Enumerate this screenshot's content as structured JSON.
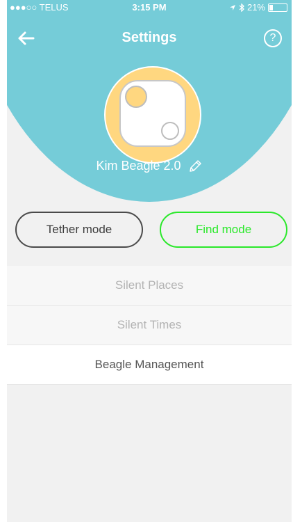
{
  "status_bar": {
    "carrier": "●●●○○ TELUS",
    "time": "3:15 PM",
    "battery": "21%",
    "battery_level": 0.21
  },
  "nav": {
    "title": "Settings",
    "help": "?"
  },
  "device": {
    "name": "Kim Beagle 2.0"
  },
  "modes": {
    "tether_label": "Tether mode",
    "find_label": "Find mode",
    "selected": "find"
  },
  "menu": [
    {
      "label": "Silent  Places",
      "enabled": false
    },
    {
      "label": "Silent  Times",
      "enabled": false
    },
    {
      "label": "Beagle Management",
      "enabled": true
    }
  ],
  "colors": {
    "header": "#75ccd8",
    "accent_green": "#2ae82a",
    "avatar": "#ffd780",
    "background": "#f1f1f1"
  }
}
